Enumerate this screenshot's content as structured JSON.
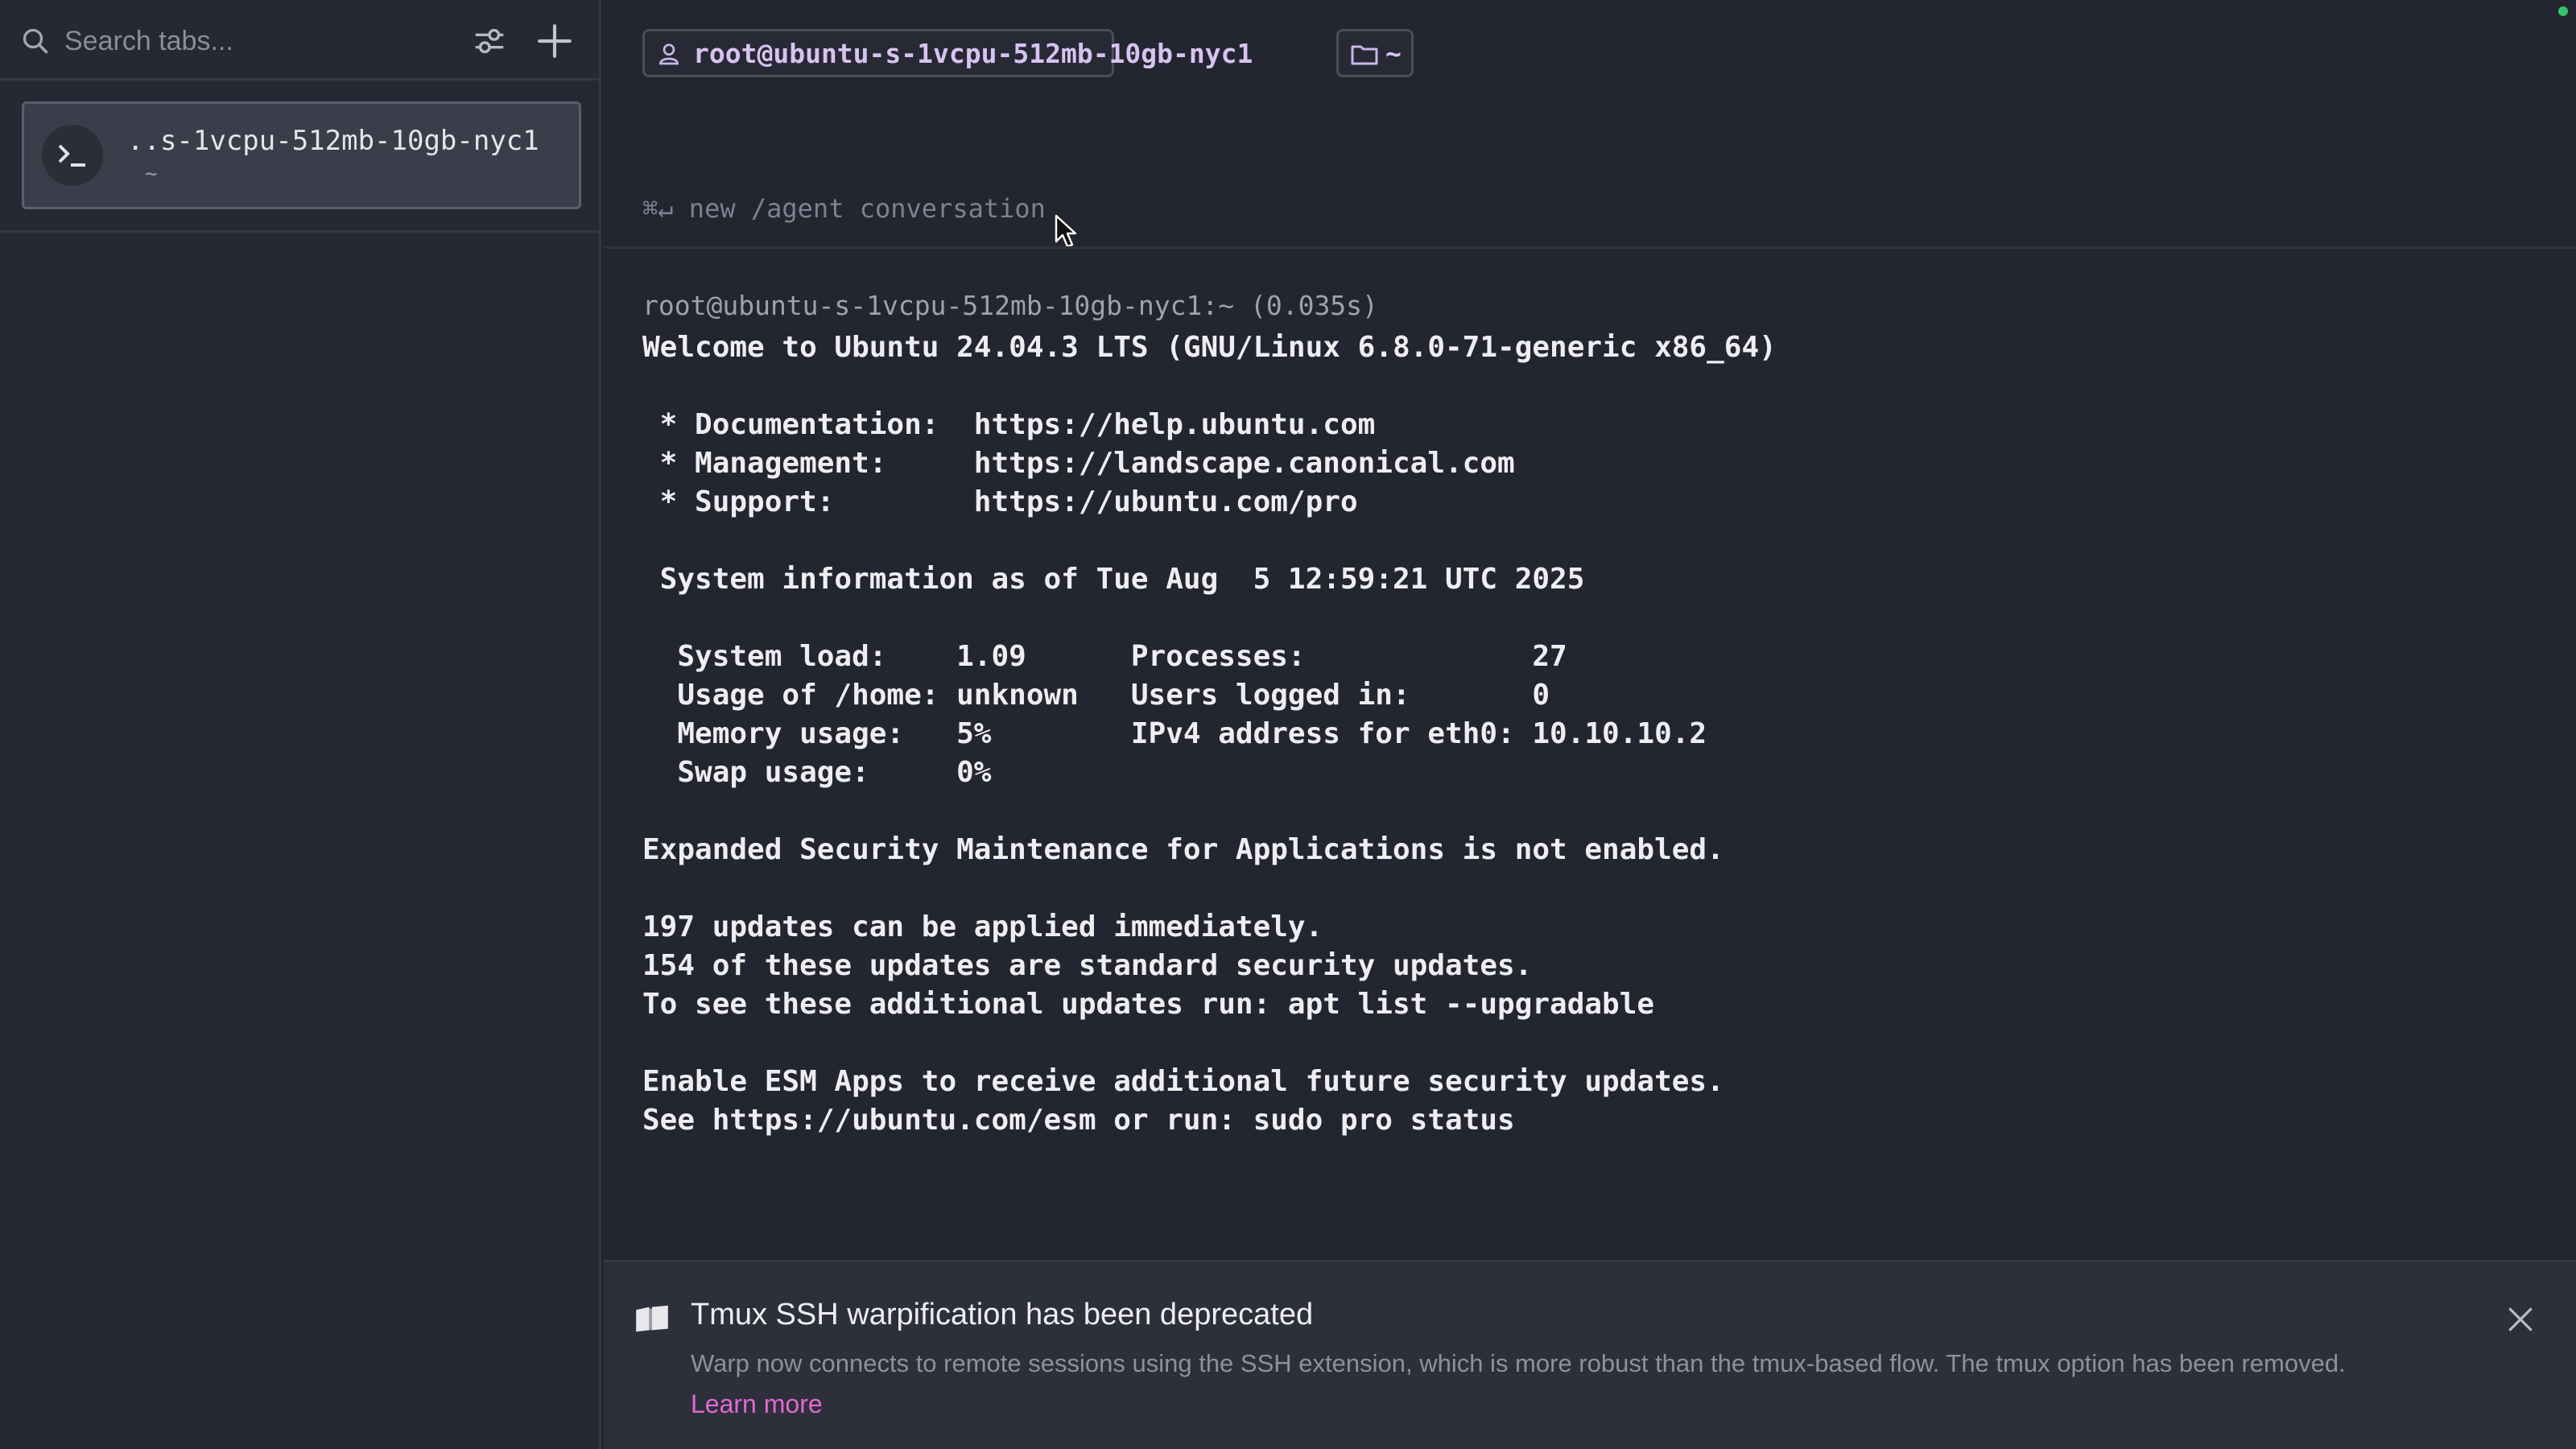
{
  "sidebar": {
    "search": {
      "placeholder": "Search tabs..."
    },
    "tabs": [
      {
        "title": "..s-1vcpu-512mb-10gb-nyc1",
        "subtitle": "~"
      }
    ]
  },
  "terminal": {
    "user_chip": "root@ubuntu-s-1vcpu-512mb-10gb-nyc1",
    "dir_chip": "~",
    "agent_hint": "⌘↵ new /agent conversation",
    "prompt": "root@ubuntu-s-1vcpu-512mb-10gb-nyc1:~ (0.035s)",
    "output": "Welcome to Ubuntu 24.04.3 LTS (GNU/Linux 6.8.0-71-generic x86_64)\n\n * Documentation:  https://help.ubuntu.com\n * Management:     https://landscape.canonical.com\n * Support:        https://ubuntu.com/pro\n\n System information as of Tue Aug  5 12:59:21 UTC 2025\n\n  System load:    1.09      Processes:             27\n  Usage of /home: unknown   Users logged in:       0\n  Memory usage:   5%        IPv4 address for eth0: 10.10.10.2\n  Swap usage:     0%\n\nExpanded Security Maintenance for Applications is not enabled.\n\n197 updates can be applied immediately.\n154 of these updates are standard security updates.\nTo see these additional updates run: apt list --upgradable\n\nEnable ESM Apps to receive additional future security updates.\nSee https://ubuntu.com/esm or run: sudo pro status"
  },
  "banner": {
    "title": "Tmux SSH warpification has been deprecated",
    "body": "Warp now connects to remote sessions using the SSH extension, which is more robust than the tmux-based flow. The tmux option has been removed.",
    "link": "Learn more"
  },
  "colors": {
    "background": "#232530",
    "sidebar": "#262833",
    "chip_text": "#d7c3f0",
    "link": "#e06ad0",
    "status_dot": "#35c46a"
  },
  "icons": [
    "search-icon",
    "filter-icon",
    "plus-icon",
    "terminal-icon",
    "user-icon",
    "folder-icon",
    "book-icon",
    "close-icon"
  ]
}
